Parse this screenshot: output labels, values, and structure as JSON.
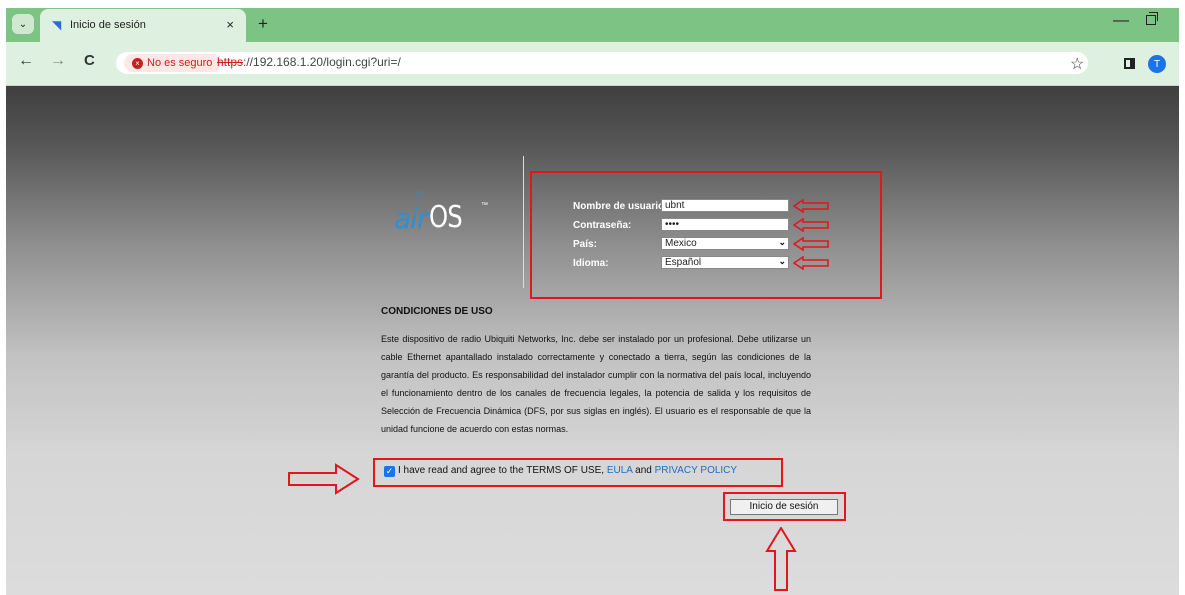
{
  "browser": {
    "tab_title": "Inicio de sesión",
    "tab_close": "×",
    "new_tab": "+",
    "menu": "⌄",
    "back": "←",
    "forward": "→",
    "reload": "C",
    "security_label": "No es seguro",
    "security_icon": "×",
    "url_scheme": "https",
    "url_rest": "://192.168.1.20/login.cgi?uri=/",
    "bookmark": "☆",
    "profile_initial": "T",
    "minimize": "—"
  },
  "logo": {
    "air": "air",
    "os": "OS",
    "tm": "™"
  },
  "login": {
    "username_label": "Nombre de usuario:",
    "username_value": "ubnt",
    "password_label": "Contraseña:",
    "password_value": "••••",
    "country_label": "País:",
    "country_value": "Mexico",
    "language_label": "Idioma:",
    "language_value": "Español",
    "select_arrow": "⌄"
  },
  "terms": {
    "title": "CONDICIONES DE USO",
    "body": "Este dispositivo de radio Ubiquiti Networks, Inc. debe ser instalado por un profesional. Debe utilizarse un cable Ethernet apantallado instalado correctamente y conectado a tierra, según las condiciones de la garantía del producto. Es responsabilidad del instalador cumplir con la normativa del país local, incluyendo el funcionamiento dentro de los canales de frecuencia legales, la potencia de salida y los requisitos de Selección de Frecuencia Dinámica (DFS, por sus siglas en inglés). El usuario es el responsable de que la unidad funcione de acuerdo con estas normas.",
    "agree_prefix": "I have read and agree to the TERMS OF USE, ",
    "eula_link": "EULA",
    "and_text": " and ",
    "privacy_link": "PRIVACY POLICY",
    "checked_mark": "✓"
  },
  "submit_label": "Inicio de sesión",
  "colors": {
    "annotation_red": "#e2161b",
    "link": "#1a6fc9",
    "brand_blue": "#2c8fd8"
  }
}
